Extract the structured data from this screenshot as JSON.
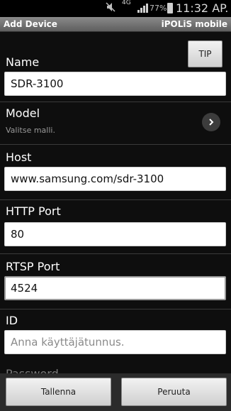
{
  "status_bar": {
    "network": "4G",
    "battery": "77%",
    "time": "11:32 AP."
  },
  "header": {
    "title": "Add Device",
    "app_name": "iPOLiS mobile"
  },
  "tip_button": {
    "label": "TIP"
  },
  "form": {
    "name": {
      "label": "Name",
      "value": "SDR-3100"
    },
    "model": {
      "label": "Model",
      "hint": "Valitse malli."
    },
    "host": {
      "label": "Host",
      "value": "www.samsung.com/sdr-3100"
    },
    "http_port": {
      "label": "HTTP Port",
      "value": "80"
    },
    "rtsp_port": {
      "label": "RTSP Port",
      "value": "4524"
    },
    "id": {
      "label": "ID",
      "placeholder": "Anna käyttäjätunnus."
    },
    "next_label_partial": "Password"
  },
  "bottom_bar": {
    "save_label": "Tallenna",
    "cancel_label": "Peruuta"
  },
  "icons": {
    "mute": "mute-icon",
    "signal": "signal-icon",
    "battery": "battery-icon",
    "chevron": "chevron-right-icon"
  },
  "colors": {
    "background": "#0e0e0e",
    "title_bar": "#6e6e6e",
    "input_bg": "#ffffff"
  }
}
